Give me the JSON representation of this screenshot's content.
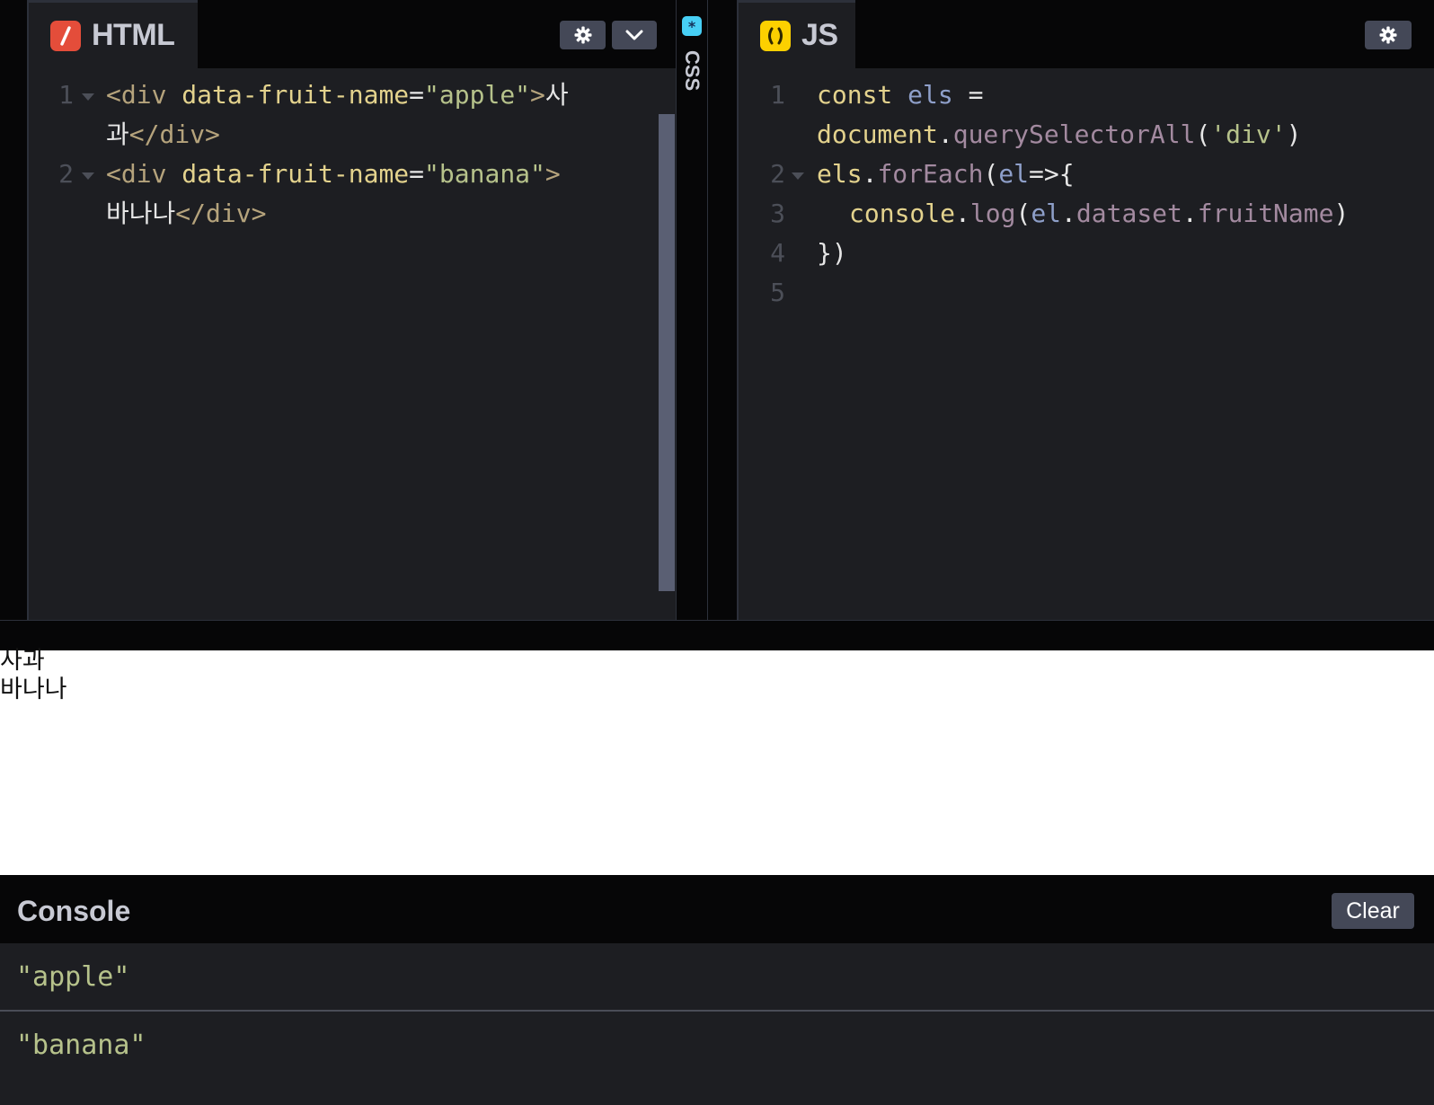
{
  "html_panel": {
    "title": "HTML",
    "lines": [
      {
        "number": "1",
        "open": "<div ",
        "attr": "data-fruit-name",
        "eq": "=",
        "val": "\"apple\"",
        "close": ">",
        "text_a": "사",
        "text_b": "과",
        "end": "</div>"
      },
      {
        "number": "2",
        "open": "<div ",
        "attr": "data-fruit-name",
        "eq": "=",
        "val": "\"banana\"",
        "close": ">",
        "text_b": "바나나",
        "end": "</div>"
      }
    ]
  },
  "css_panel": {
    "title": "CSS"
  },
  "js_panel": {
    "title": "JS",
    "line_numbers": [
      "1",
      "2",
      "3",
      "4",
      "5"
    ],
    "l1": {
      "kw": "const",
      "var": "els",
      "op": "="
    },
    "l1b": {
      "obj": "document",
      "dot": ".",
      "fn": "querySelectorAll",
      "open": "(",
      "str": "'div'",
      "close": ")"
    },
    "l2": {
      "obj": "els",
      "dot": ".",
      "fn": "forEach",
      "open": "(",
      "param": "el",
      "arrow": "=>{"
    },
    "l3": {
      "obj": "console",
      "dot1": ".",
      "fn": "log",
      "open": "(",
      "el": "el",
      "dot2": ".",
      "prop1": "dataset",
      "dot3": ".",
      "prop2": "fruitName",
      "close": ")"
    },
    "l4": {
      "text": "})"
    }
  },
  "preview": {
    "line1": "사과",
    "line2": "바나나"
  },
  "console": {
    "title": "Console",
    "clear_label": "Clear",
    "entries": [
      "\"apple\"",
      "\"banana\""
    ]
  }
}
